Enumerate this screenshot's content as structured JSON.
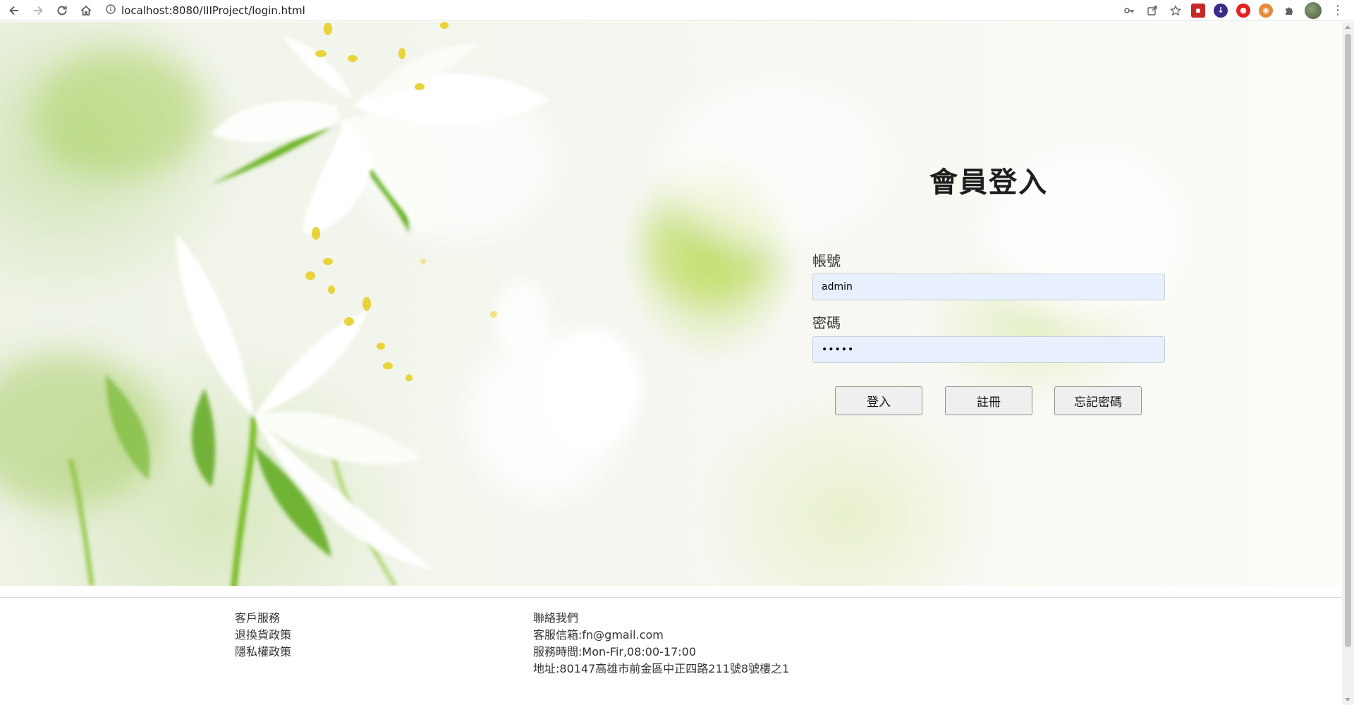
{
  "browser": {
    "url": "localhost:8080/IIIProject/login.html",
    "icons": [
      "back-icon",
      "forward-icon",
      "reload-icon",
      "home-icon",
      "info-icon",
      "key-icon",
      "share-icon",
      "star-icon",
      "extension-icon",
      "puzzle-icon",
      "avatar",
      "menu-icon"
    ]
  },
  "login": {
    "title": "會員登入",
    "account_label": "帳號",
    "account_value": "admin",
    "password_label": "密碼",
    "password_value": "•••••",
    "login_button": "登入",
    "register_button": "註冊",
    "forgot_button": "忘記密碼"
  },
  "footer": {
    "service_links": [
      "客戶服務",
      "退換貨政策",
      "隱私權政策"
    ],
    "contact": [
      "聯絡我們",
      "客服信箱:fn@gmail.com",
      "服務時間:Mon-Fir,08:00-17:00",
      "地址:80147高雄市前金區中正四路211號8號樓之1"
    ]
  },
  "colors": {
    "input_bg": "#e8f0fe",
    "button_bg": "#efefef",
    "title": "#1e1e1e"
  }
}
